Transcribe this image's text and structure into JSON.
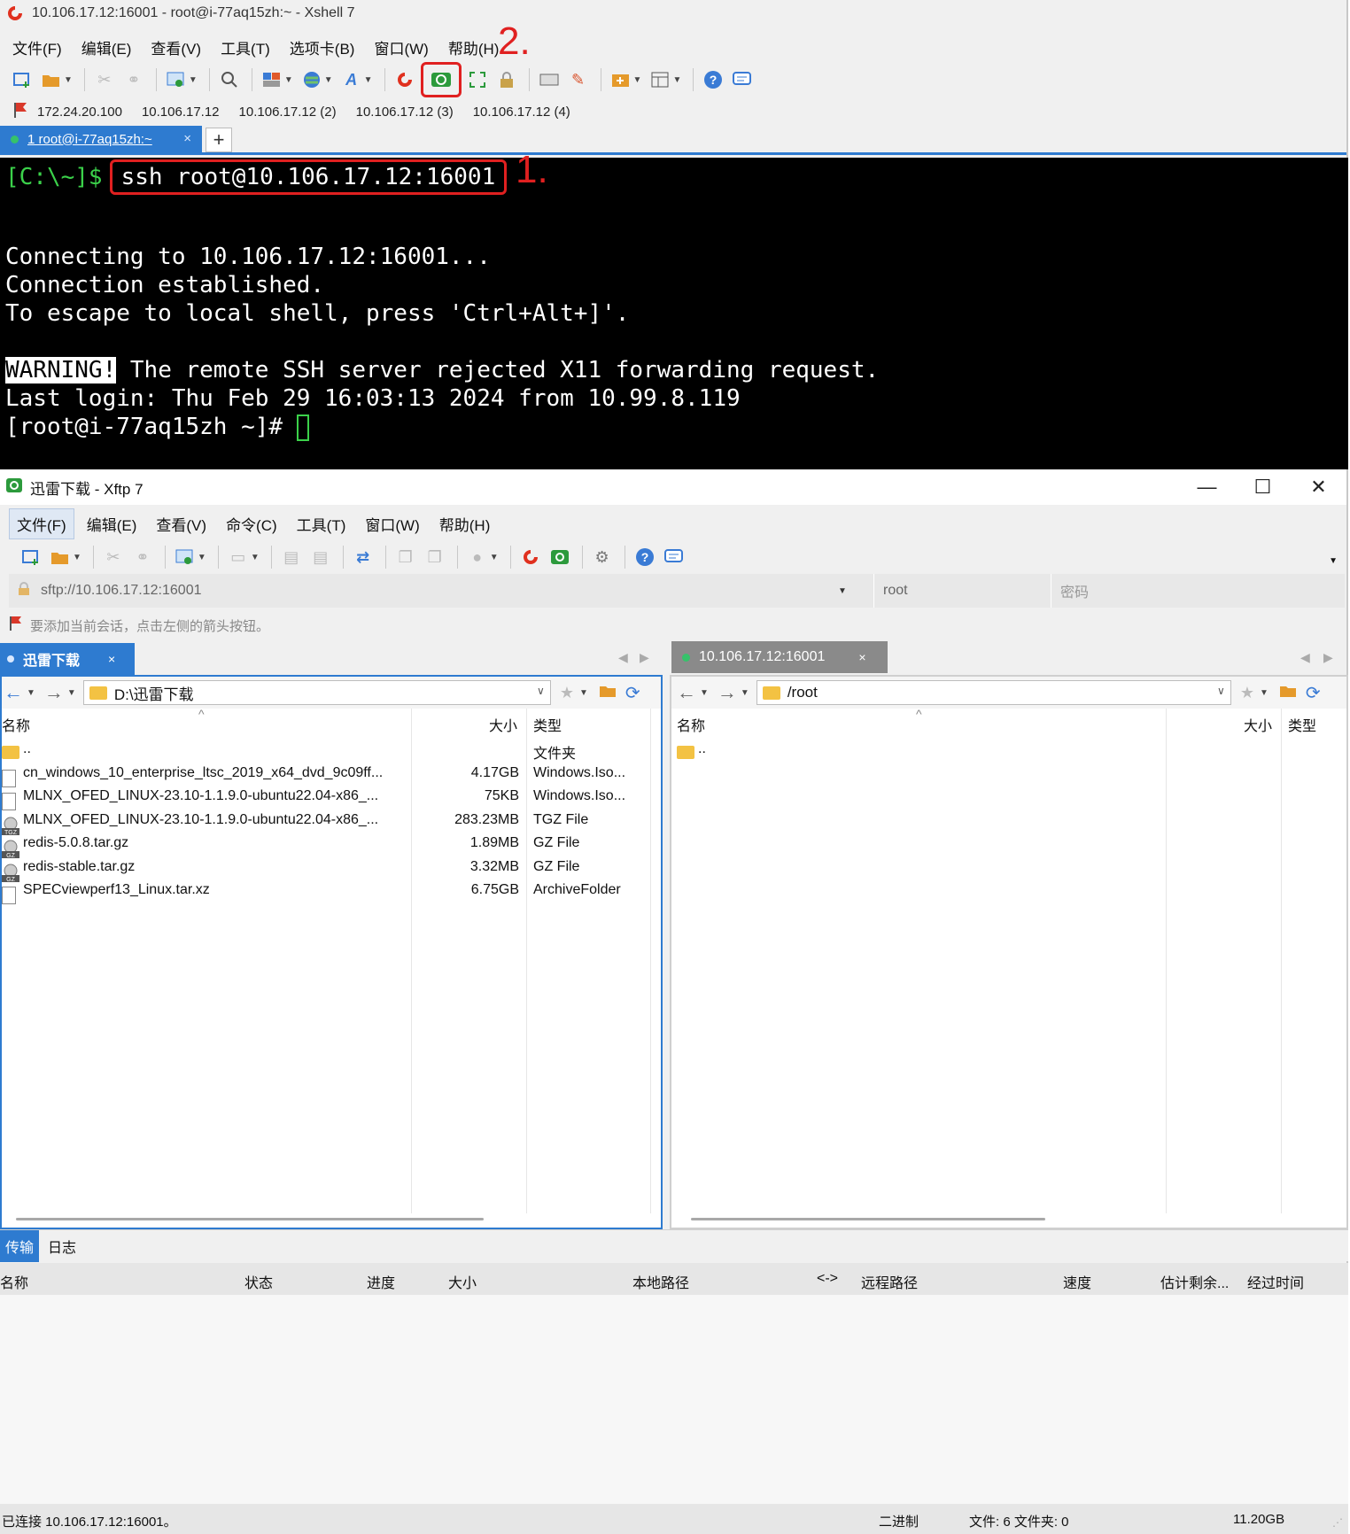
{
  "xshell": {
    "title": "10.106.17.12:16001 - root@i-77aq15zh:~ - Xshell 7",
    "menu": [
      "文件(F)",
      "编辑(E)",
      "查看(V)",
      "工具(T)",
      "选项卡(B)",
      "窗口(W)",
      "帮助(H)"
    ],
    "links": [
      "172.24.20.100",
      "10.106.17.12",
      "10.106.17.12 (2)",
      "10.106.17.12 (3)",
      "10.106.17.12 (4)"
    ],
    "tab_label": "1 root@i-77aq15zh:~",
    "annotations": {
      "one": "1.",
      "two": "2."
    },
    "terminal": {
      "prompt": "[C:\\~]$",
      "command": "ssh root@10.106.17.12:16001",
      "line1": "Connecting to 10.106.17.12:16001...",
      "line2": "Connection established.",
      "line3": "To escape to local shell, press 'Ctrl+Alt+]'.",
      "warning_tag": "WARNING!",
      "warning_text": " The remote SSH server rejected X11 forwarding request.",
      "last_login": "Last login: Thu Feb 29 16:03:13 2024 from 10.99.8.119",
      "remote_prompt": "[root@i-77aq15zh ~]# "
    }
  },
  "xftp": {
    "title": "迅雷下载 - Xftp 7",
    "menu": [
      "文件(F)",
      "编辑(E)",
      "查看(V)",
      "命令(C)",
      "工具(T)",
      "窗口(W)",
      "帮助(H)"
    ],
    "address": "sftp://10.106.17.12:16001",
    "user": "root",
    "password_placeholder": "密码",
    "hint": "要添加当前会话，点击左侧的箭头按钮。",
    "left": {
      "tab": "迅雷下载",
      "path": "D:\\迅雷下载",
      "columns": [
        "名称",
        "大小",
        "类型"
      ],
      "rows": [
        {
          "name": "..",
          "size": "",
          "type": "文件夹",
          "icon": "folder"
        },
        {
          "name": "cn_windows_10_enterprise_ltsc_2019_x64_dvd_9c09ff...",
          "size": "4.17GB",
          "type": "Windows.Iso...",
          "icon": "file"
        },
        {
          "name": "MLNX_OFED_LINUX-23.10-1.1.9.0-ubuntu22.04-x86_...",
          "size": "75KB",
          "type": "Windows.Iso...",
          "icon": "file"
        },
        {
          "name": "MLNX_OFED_LINUX-23.10-1.1.9.0-ubuntu22.04-x86_...",
          "size": "283.23MB",
          "type": "TGZ File",
          "icon": "tgz"
        },
        {
          "name": "redis-5.0.8.tar.gz",
          "size": "1.89MB",
          "type": "GZ File",
          "icon": "gz"
        },
        {
          "name": "redis-stable.tar.gz",
          "size": "3.32MB",
          "type": "GZ File",
          "icon": "gz"
        },
        {
          "name": "SPECviewperf13_Linux.tar.xz",
          "size": "6.75GB",
          "type": "ArchiveFolder",
          "icon": "file"
        }
      ]
    },
    "right": {
      "tab": "10.106.17.12:16001",
      "path": "/root",
      "columns": [
        "名称",
        "大小",
        "类型"
      ],
      "rows": [
        {
          "name": "..",
          "icon": "folder"
        }
      ]
    },
    "bottom_tabs": [
      "传输",
      "日志"
    ],
    "transfer_columns": [
      "名称",
      "状态",
      "进度",
      "大小",
      "本地路径",
      "<->",
      "远程路径",
      "速度",
      "估计剩余...",
      "经过时间"
    ],
    "status": {
      "connected": "已连接 10.106.17.12:16001。",
      "mode": "二进制",
      "counts": "文件: 6  文件夹: 0",
      "size": "11.20GB"
    }
  },
  "colors": {
    "accent": "#2e7bd0",
    "annotation": "#e02020",
    "terminal_green": "#3bd14a"
  }
}
